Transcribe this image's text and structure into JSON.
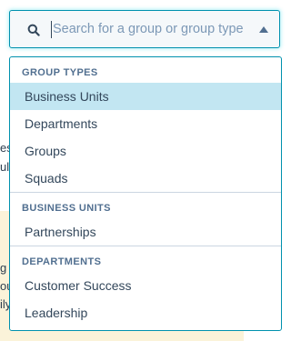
{
  "search": {
    "placeholder": "Search for a group or group type",
    "value": ""
  },
  "background_fragments": [
    "es",
    "ull",
    "g",
    "ou",
    "ily"
  ],
  "groups": [
    {
      "header": "GROUP TYPES",
      "options": [
        {
          "label": "Business Units",
          "selected": true
        },
        {
          "label": "Departments",
          "selected": false
        },
        {
          "label": "Groups",
          "selected": false
        },
        {
          "label": "Squads",
          "selected": false
        }
      ]
    },
    {
      "header": "BUSINESS UNITS",
      "options": [
        {
          "label": "Partnerships",
          "selected": false
        }
      ]
    },
    {
      "header": "DEPARTMENTS",
      "options": [
        {
          "label": "Customer Success",
          "selected": false
        },
        {
          "label": "Leadership",
          "selected": false
        }
      ]
    }
  ],
  "colors": {
    "accent_border": "#0091ae",
    "selected_bg": "#c2e6f2",
    "header_text": "#516f90",
    "option_text": "#33475b",
    "background_highlight": "#fbf3d9"
  },
  "icons": {
    "search": "search-icon",
    "dropdown_arrow": "caret-up-icon"
  }
}
